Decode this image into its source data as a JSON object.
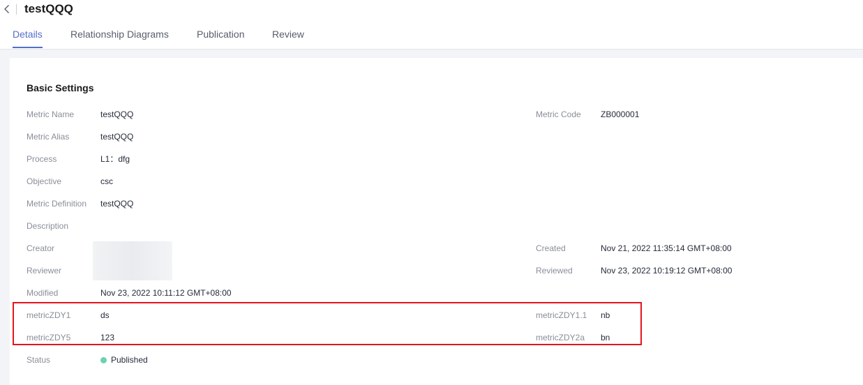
{
  "header": {
    "title": "testQQQ",
    "tabs": [
      {
        "label": "Details",
        "active": true
      },
      {
        "label": "Relationship Diagrams",
        "active": false
      },
      {
        "label": "Publication",
        "active": false
      },
      {
        "label": "Review",
        "active": false
      }
    ]
  },
  "section": {
    "title": "Basic Settings"
  },
  "fields": {
    "metric_name": {
      "label": "Metric Name",
      "value": "testQQQ"
    },
    "metric_code": {
      "label": "Metric Code",
      "value": "ZB000001"
    },
    "metric_alias": {
      "label": "Metric Alias",
      "value": "testQQQ"
    },
    "process": {
      "label": "Process",
      "value": "L1：dfg"
    },
    "objective": {
      "label": "Objective",
      "value": "csc"
    },
    "metric_definition": {
      "label": "Metric Definition",
      "value": "testQQQ"
    },
    "description": {
      "label": "Description",
      "value": ""
    },
    "creator": {
      "label": "Creator"
    },
    "created": {
      "label": "Created",
      "value": "Nov 21, 2022 11:35:14 GMT+08:00"
    },
    "reviewer": {
      "label": "Reviewer"
    },
    "reviewed": {
      "label": "Reviewed",
      "value": "Nov 23, 2022 10:19:12 GMT+08:00"
    },
    "modified": {
      "label": "Modified",
      "value": "Nov 23, 2022 10:11:12 GMT+08:00"
    },
    "metric_zdy1": {
      "label": "metricZDY1",
      "value": "ds"
    },
    "metric_zdy1_1": {
      "label": "metricZDY1.1",
      "value": "nb"
    },
    "metric_zdy5": {
      "label": "metricZDY5",
      "value": "123"
    },
    "metric_zdy2a": {
      "label": "metricZDY2a",
      "value": "bn"
    },
    "status": {
      "label": "Status",
      "value": "Published"
    }
  },
  "colors": {
    "accent": "#526ecc",
    "highlight_border": "#e5141c",
    "status_published": "#6cd2b0"
  },
  "icons": {
    "back": "chevron-left-icon",
    "status": "status-dot-icon"
  }
}
